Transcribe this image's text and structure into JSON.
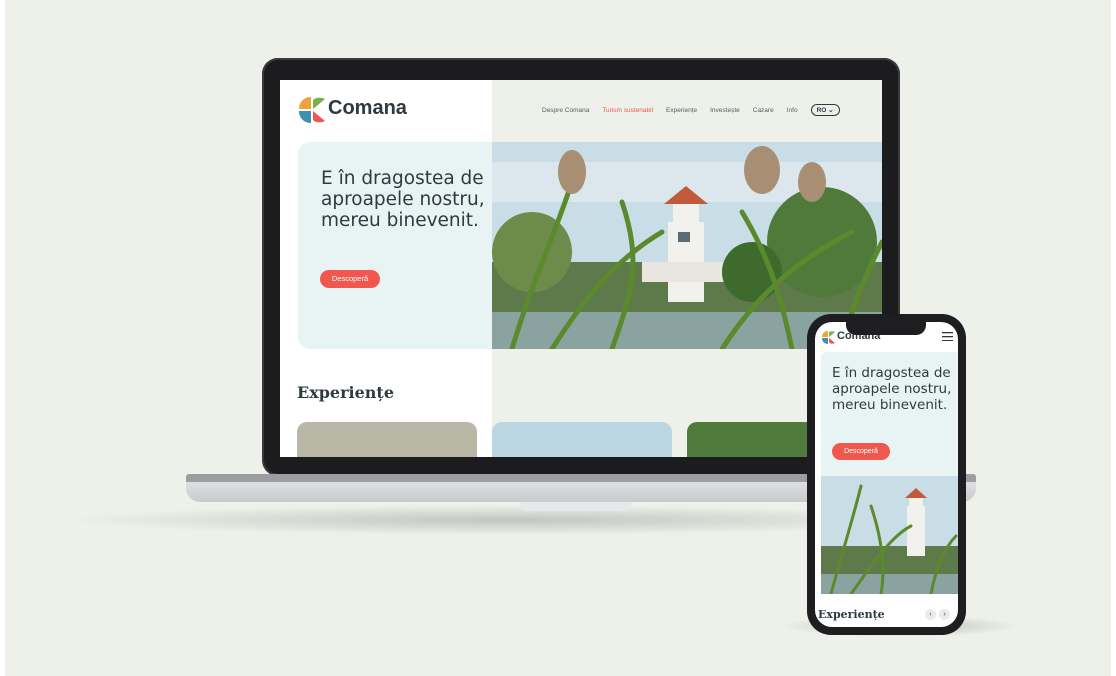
{
  "desktop": {
    "brand": "Comana",
    "nav": [
      {
        "label": "Despre Comana",
        "active": false
      },
      {
        "label": "Turism sustenabil",
        "active": true
      },
      {
        "label": "Experiențe",
        "active": false
      },
      {
        "label": "Investește",
        "active": false
      },
      {
        "label": "Cazare",
        "active": false
      },
      {
        "label": "Info",
        "active": false
      }
    ],
    "lang": "RO ⌄",
    "hero_text": "E în dragostea de aproapele nostru, mereu binevenit.",
    "cta": "Descoperă",
    "section_title": "Experiențe"
  },
  "mobile": {
    "brand": "Comana",
    "hero_text": "E în dragostea de aproapele nostru, mereu binevenit.",
    "cta": "Descoperă",
    "section_title": "Experiențe",
    "prev": "‹",
    "next": "›"
  },
  "colors": {
    "accent": "#f0574f",
    "text": "#2f3a3f",
    "hero_bg": "#e8f4f3",
    "backdrop": "#edf1ea"
  },
  "icons": {
    "logo": "comana-logo-icon",
    "menu": "hamburger-menu-icon"
  }
}
